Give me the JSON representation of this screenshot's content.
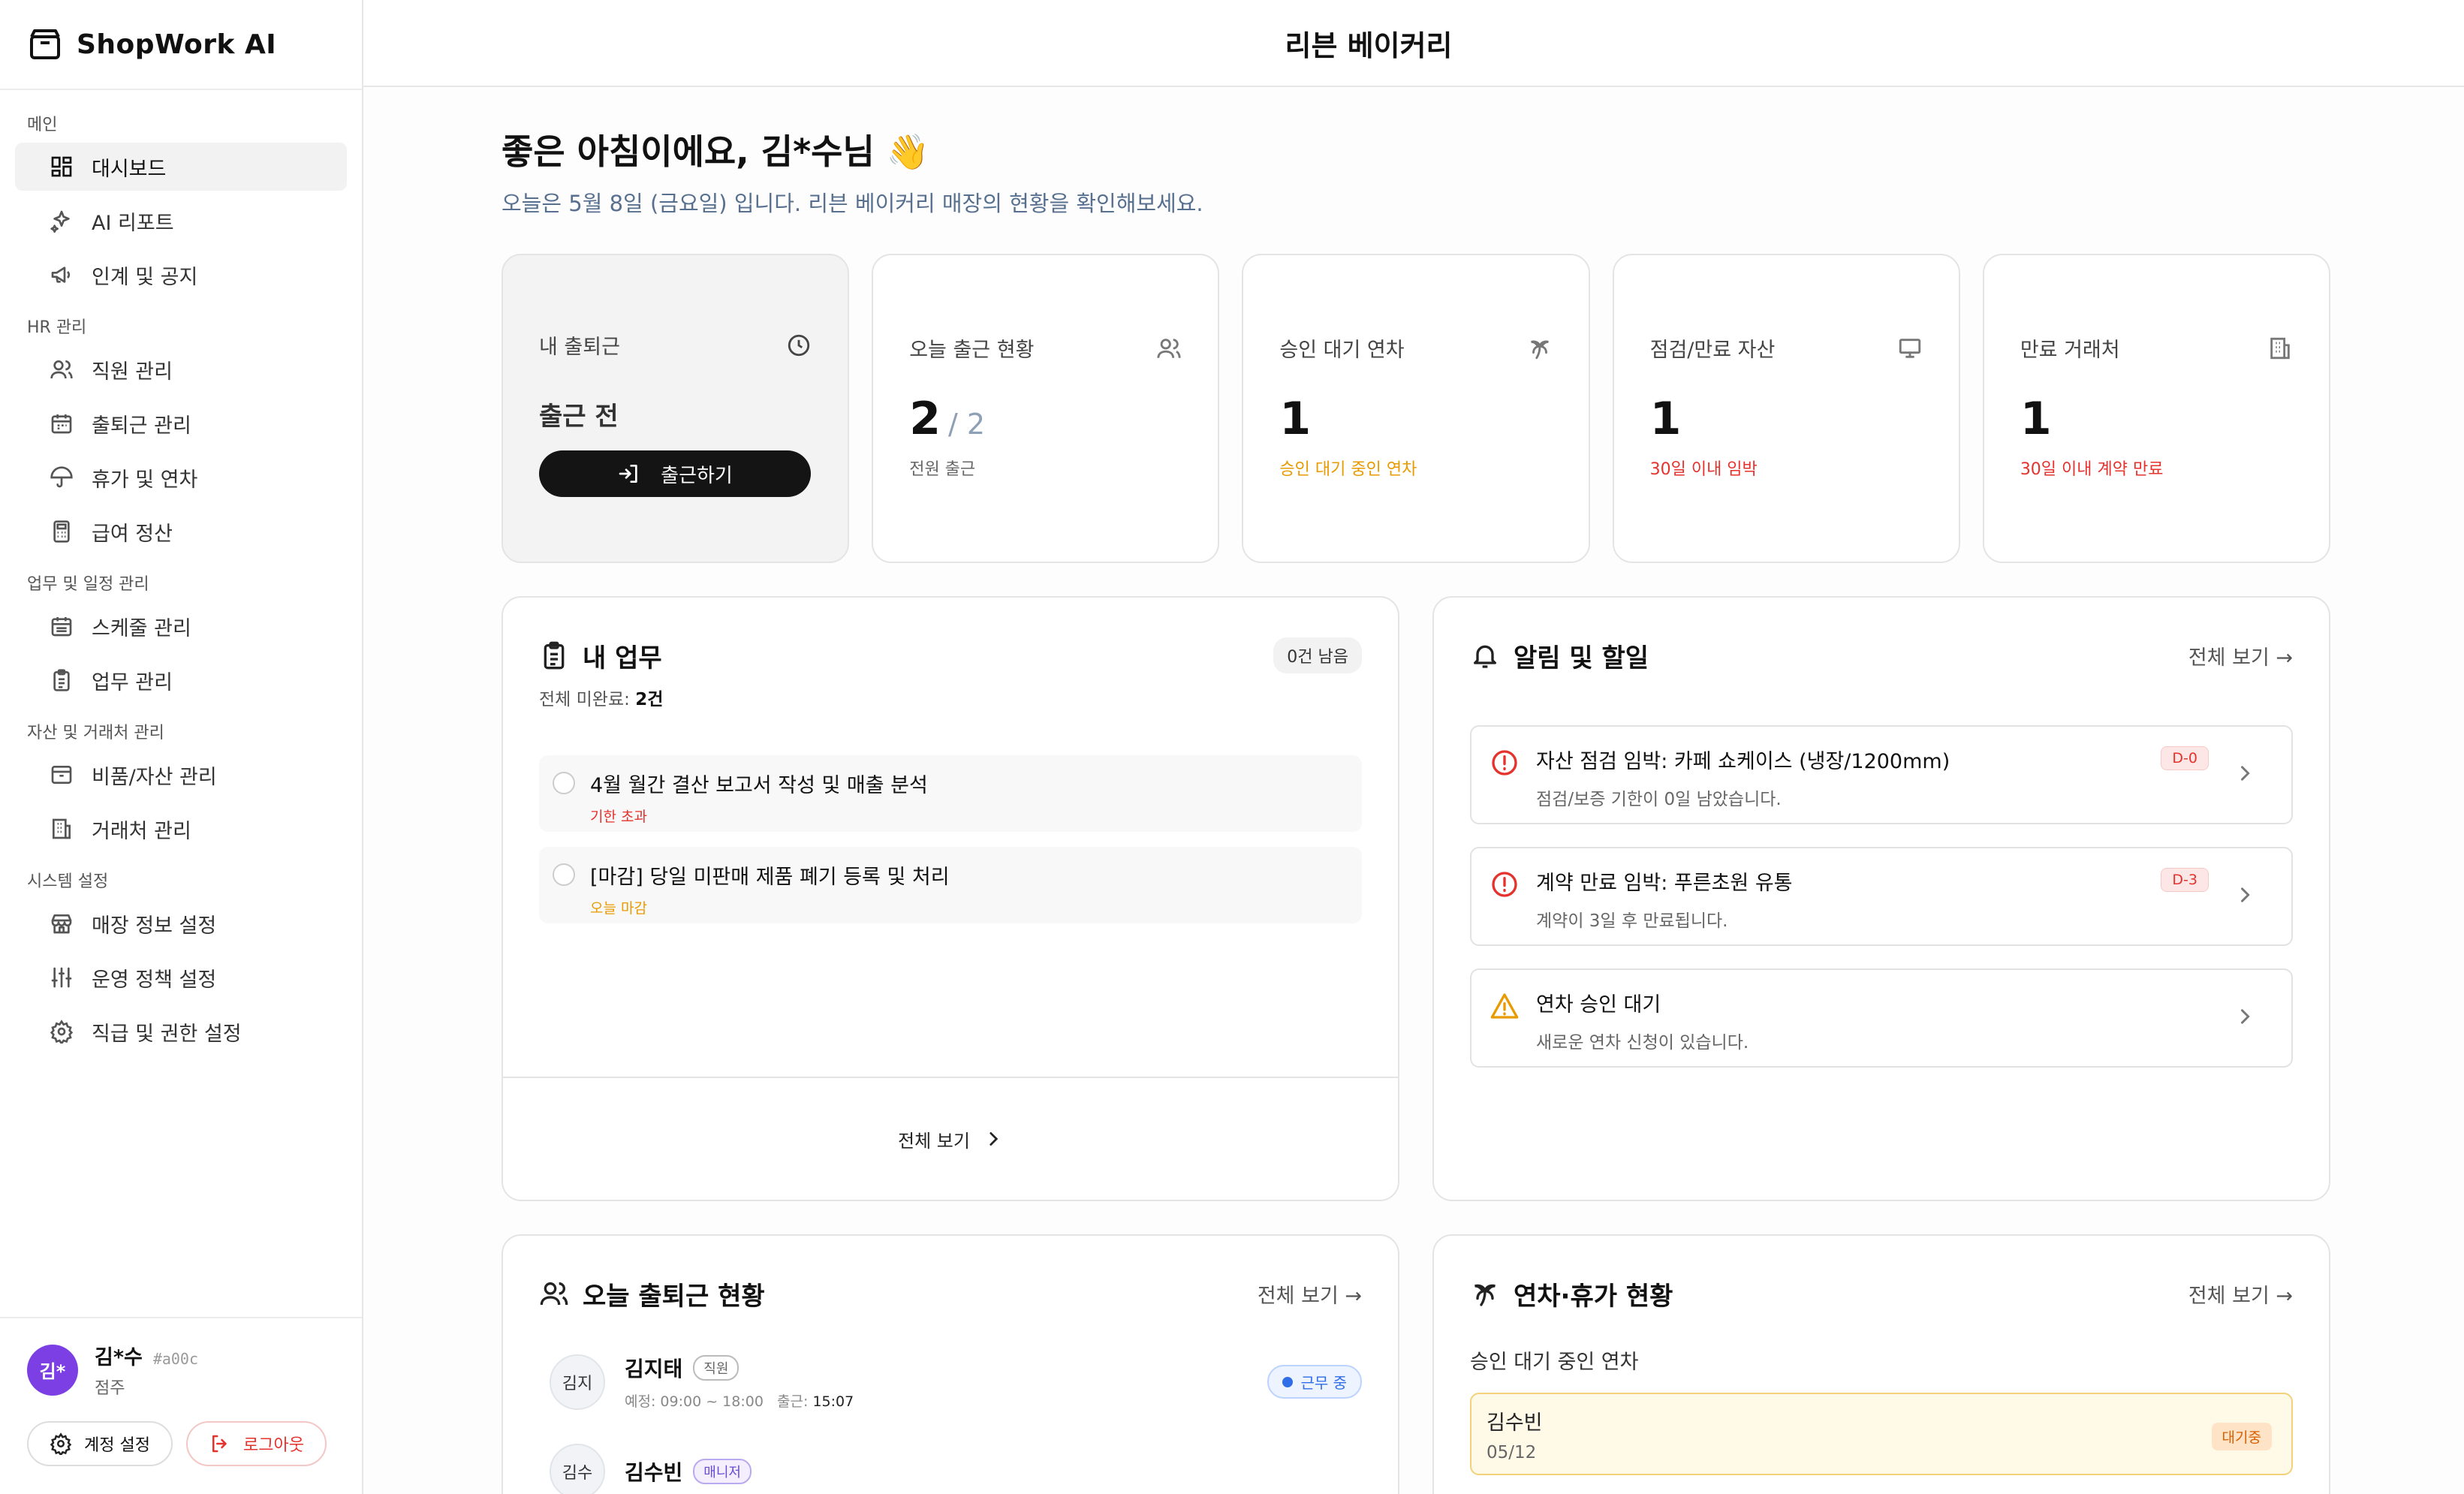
{
  "app": {
    "name": "ShopWork AI"
  },
  "store": {
    "name": "리븐 베이커리"
  },
  "sidebar": {
    "sections": [
      {
        "label": "메인",
        "items": [
          {
            "label": "대시보드",
            "icon": "dashboard-icon",
            "active": true
          },
          {
            "label": "AI 리포트",
            "icon": "sparkles-icon"
          },
          {
            "label": "인계 및 공지",
            "icon": "megaphone-icon"
          }
        ]
      },
      {
        "label": "HR 관리",
        "items": [
          {
            "label": "직원 관리",
            "icon": "users-icon"
          },
          {
            "label": "출퇴근 관리",
            "icon": "calendar-icon"
          },
          {
            "label": "휴가 및 연차",
            "icon": "umbrella-icon"
          },
          {
            "label": "급여 정산",
            "icon": "calculator-icon"
          }
        ]
      },
      {
        "label": "업무 및 일정 관리",
        "items": [
          {
            "label": "스케줄 관리",
            "icon": "calendar-grid-icon"
          },
          {
            "label": "업무 관리",
            "icon": "clipboard-icon"
          }
        ]
      },
      {
        "label": "자산 및 거래처 관리",
        "items": [
          {
            "label": "비품/자산 관리",
            "icon": "box-icon"
          },
          {
            "label": "거래처 관리",
            "icon": "building-icon"
          }
        ]
      },
      {
        "label": "시스템 설정",
        "items": [
          {
            "label": "매장 정보 설정",
            "icon": "store-icon"
          },
          {
            "label": "운영 정책 설정",
            "icon": "sliders-icon"
          },
          {
            "label": "직급 및 권한 설정",
            "icon": "gear-icon"
          }
        ]
      }
    ]
  },
  "user": {
    "avatar": "김*",
    "name": "김*수",
    "code": "#a00c",
    "role": "점주"
  },
  "footer": {
    "settings": "계정 설정",
    "logout": "로그아웃"
  },
  "greeting": {
    "title": "좋은 아침이에요, 김*수님 👋",
    "subtitle": "오늘은 5월 8일 (금요일) 입니다. 리븐 베이커리 매장의 현황을 확인해보세요."
  },
  "clock": {
    "title": "내 출퇴근",
    "status": "출근 전",
    "button": "출근하기"
  },
  "stats": {
    "attendance": {
      "title": "오늘 출근 현황",
      "value": "2",
      "total": "/ 2",
      "note": "전원 출근"
    },
    "leave": {
      "title": "승인 대기 연차",
      "value": "1",
      "note": "승인 대기 중인 연차"
    },
    "assets": {
      "title": "점검/만료 자산",
      "value": "1",
      "note": "30일 이내 임박"
    },
    "vendors": {
      "title": "만료 거래처",
      "value": "1",
      "note": "30일 이내 계약 만료"
    }
  },
  "tasks": {
    "title": "내 업무",
    "remaining": "0건 남음",
    "summary_label": "전체 미완료:",
    "summary_value": "2건",
    "items": [
      {
        "title": "4월 월간 결산 보고서 작성 및 매출 분석",
        "tag": "기한 초과"
      },
      {
        "title": "[마감] 당일 미판매 제품 폐기 등록 및 처리",
        "tag": "오늘 마감"
      }
    ],
    "view_all": "전체 보기"
  },
  "alerts": {
    "title": "알림 및 할일",
    "view_all": "전체 보기 →",
    "items": [
      {
        "title": "자산 점검 임박: 카페 쇼케이스 (냉장/1200mm)",
        "desc": "점검/보증 기한이 0일 남았습니다.",
        "badge": "D-0"
      },
      {
        "title": "계약 만료 임박: 푸른초원 유통",
        "desc": "계약이 3일 후 만료됩니다.",
        "badge": "D-3"
      },
      {
        "title": "연차 승인 대기",
        "desc": "새로운 연차 신청이 있습니다."
      }
    ]
  },
  "attendance_panel": {
    "title": "오늘 출퇴근 현황",
    "view_all": "전체 보기 →",
    "rows": [
      {
        "avatar": "김지",
        "name": "김지태",
        "role": "직원",
        "sched": "예정: 09:00 ~ 18:00",
        "in_label": "출근:",
        "in_time": "15:07",
        "status": "근무 중"
      },
      {
        "avatar": "김수",
        "name": "김수빈",
        "role": "매니저",
        "sched": "",
        "in_label": "",
        "in_time": "",
        "status": ""
      }
    ]
  },
  "leave_panel": {
    "title": "연차·휴가 현황",
    "view_all": "전체 보기 →",
    "subtitle": "승인 대기 중인 연차",
    "card": {
      "name": "김수빈",
      "date": "05/12",
      "badge": "대기중"
    }
  },
  "colors": {
    "accent": "#7b3fe4",
    "danger": "#e5322d",
    "warning": "#e89a00",
    "info": "#2f6ee6"
  }
}
